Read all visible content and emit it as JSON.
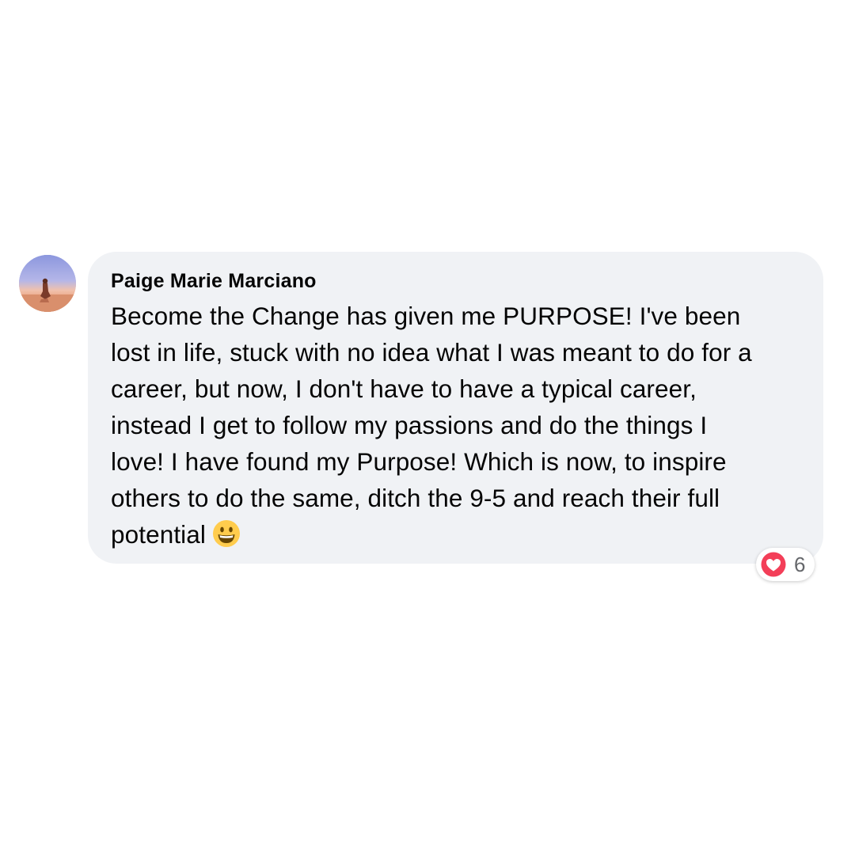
{
  "comment": {
    "author": "Paige Marie Marciano",
    "text_lines": [
      "Become the Change has given me PURPOSE! I've been",
      "lost in life, stuck with no idea what I was meant to do for a",
      "career, but now, I don't have to have a typical career,",
      "instead I get to follow my passions and do the things I",
      "love! I have found my Purpose! Which is now, to inspire",
      "others to do the same, ditch the 9-5 and reach their full",
      "potential"
    ],
    "trailing_emoji": "grinning-face-emoji",
    "reaction": {
      "icon": "heart-icon",
      "count": "6",
      "color": "#f33e58"
    }
  },
  "colors": {
    "bubble_background": "#f0f2f5",
    "text": "#050505",
    "count_text": "#65676b"
  }
}
